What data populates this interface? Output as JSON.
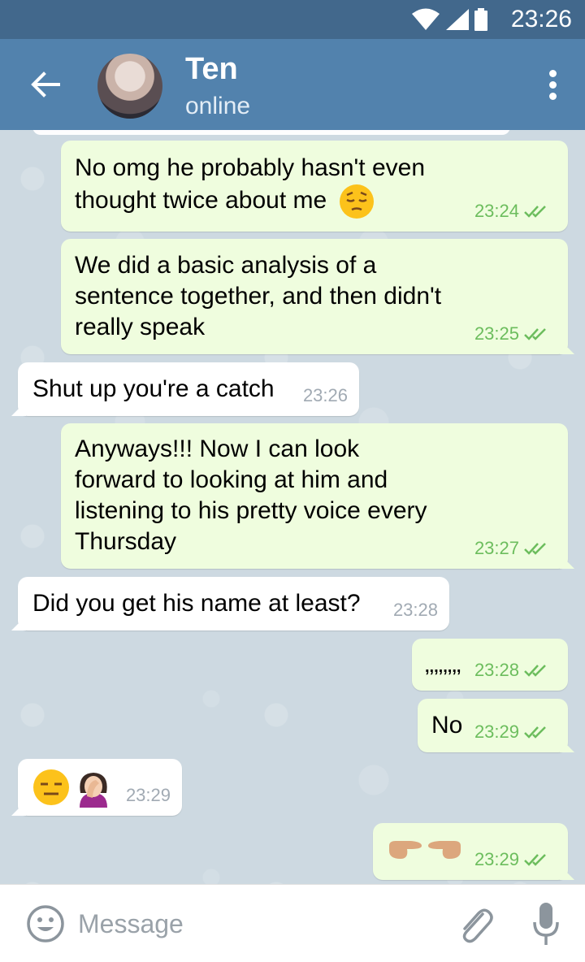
{
  "status_bar": {
    "time": "23:26"
  },
  "header": {
    "name": "Ten",
    "status": "online"
  },
  "messages": [
    {
      "dir": "out",
      "lines": [
        "No omg he probably hasn't even",
        "thought twice about me"
      ],
      "time": "23:24"
    },
    {
      "dir": "out",
      "lines": [
        "We did a basic analysis of a",
        "sentence together, and then didn't",
        "really speak"
      ],
      "time": "23:25"
    },
    {
      "dir": "in",
      "lines": [
        "Shut up you're a catch"
      ],
      "time": "23:26"
    },
    {
      "dir": "out",
      "lines": [
        "Anyways!!! Now I can look",
        "forward to looking at him and",
        "listening to his pretty voice every",
        "Thursday"
      ],
      "time": "23:27"
    },
    {
      "dir": "in",
      "lines": [
        "Did you get his name at least?"
      ],
      "time": "23:28"
    },
    {
      "dir": "out",
      "lines": [
        ",,,,,,,,"
      ],
      "time": "23:28"
    },
    {
      "dir": "out",
      "lines": [
        "No"
      ],
      "time": "23:29"
    },
    {
      "dir": "in",
      "lines": [
        ""
      ],
      "time": "23:29",
      "emoji": [
        "expressionless-face",
        "woman-facepalming"
      ]
    },
    {
      "dir": "out",
      "lines": [
        ""
      ],
      "time": "23:29",
      "emoji": [
        "pointing-hands"
      ]
    }
  ],
  "input": {
    "placeholder": "Message"
  },
  "colors": {
    "header": "#5282ad",
    "statusbar": "#42688c",
    "outgoing": "#effdde",
    "incoming": "#ffffff",
    "check": "#6cbd5d"
  }
}
